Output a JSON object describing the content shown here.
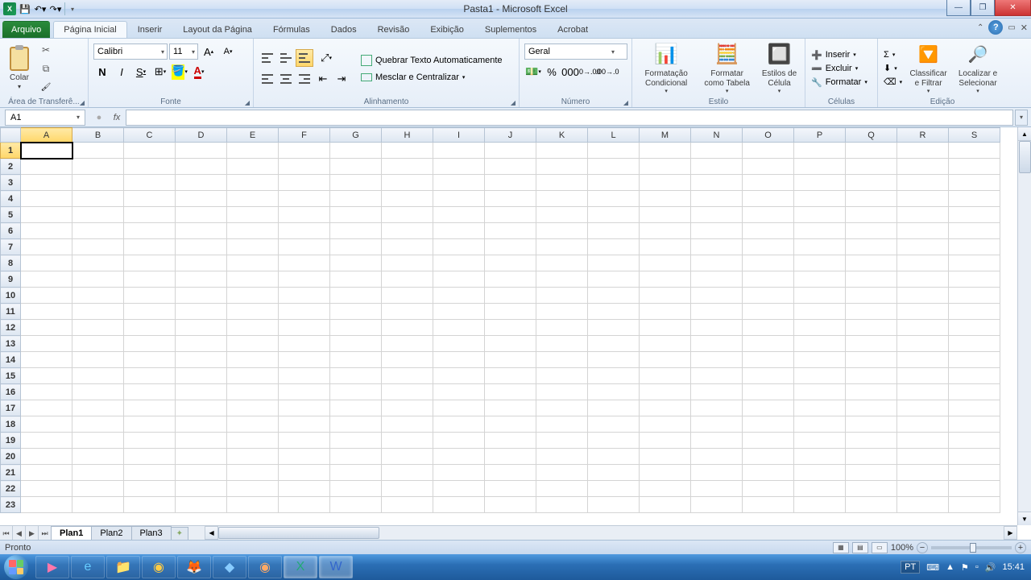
{
  "window": {
    "title": "Pasta1 - Microsoft Excel"
  },
  "qat": {
    "save": "💾",
    "undo": "↶",
    "redo": "↷"
  },
  "tabs": {
    "file": "Arquivo",
    "items": [
      "Página Inicial",
      "Inserir",
      "Layout da Página",
      "Fórmulas",
      "Dados",
      "Revisão",
      "Exibição",
      "Suplementos",
      "Acrobat"
    ],
    "active_index": 0
  },
  "ribbon": {
    "clipboard": {
      "title": "Área de Transferê...",
      "paste": "Colar"
    },
    "font": {
      "title": "Fonte",
      "name": "Calibri",
      "size": "11",
      "bold": "N",
      "italic": "I",
      "underline": "S"
    },
    "alignment": {
      "title": "Alinhamento",
      "wrap": "Quebrar Texto Automaticamente",
      "merge": "Mesclar e Centralizar"
    },
    "number": {
      "title": "Número",
      "format": "Geral",
      "percent": "%",
      "comma": "000"
    },
    "styles": {
      "title": "Estilo",
      "cond": "Formatação Condicional",
      "table": "Formatar como Tabela",
      "cell": "Estilos de Célula"
    },
    "cells": {
      "title": "Células",
      "insert": "Inserir",
      "delete": "Excluir",
      "format": "Formatar"
    },
    "editing": {
      "title": "Edição",
      "sort": "Classificar e Filtrar",
      "find": "Localizar e Selecionar"
    }
  },
  "namebox": {
    "value": "A1"
  },
  "formula": {
    "fx": "fx",
    "value": ""
  },
  "columns": [
    "A",
    "B",
    "C",
    "D",
    "E",
    "F",
    "G",
    "H",
    "I",
    "J",
    "K",
    "L",
    "M",
    "N",
    "O",
    "P",
    "Q",
    "R",
    "S"
  ],
  "rows": [
    1,
    2,
    3,
    4,
    5,
    6,
    7,
    8,
    9,
    10,
    11,
    12,
    13,
    14,
    15,
    16,
    17,
    18,
    19,
    20,
    21,
    22,
    23
  ],
  "active_cell": {
    "col": "A",
    "row": 1
  },
  "sheets": {
    "items": [
      "Plan1",
      "Plan2",
      "Plan3"
    ],
    "active_index": 0
  },
  "status": {
    "ready": "Pronto",
    "zoom": "100%"
  },
  "taskbar": {
    "lang": "PT",
    "clock": "15:41",
    "apps": [
      {
        "name": "media-player",
        "glyph": "▶",
        "color": "#f7a",
        "active": false
      },
      {
        "name": "ie-browser",
        "glyph": "e",
        "color": "#6cf",
        "active": false
      },
      {
        "name": "file-explorer",
        "glyph": "📁",
        "color": "#fc6",
        "active": false
      },
      {
        "name": "chrome-browser",
        "glyph": "◉",
        "color": "#fc4",
        "active": false
      },
      {
        "name": "firefox-browser",
        "glyph": "🦊",
        "color": "#f72",
        "active": false
      },
      {
        "name": "app-unknown1",
        "glyph": "◆",
        "color": "#8cf",
        "active": false
      },
      {
        "name": "app-unknown2",
        "glyph": "◉",
        "color": "#fa6",
        "active": false
      },
      {
        "name": "excel-app",
        "glyph": "X",
        "color": "#2a7",
        "active": true
      },
      {
        "name": "word-app",
        "glyph": "W",
        "color": "#36c",
        "active": true
      }
    ]
  }
}
